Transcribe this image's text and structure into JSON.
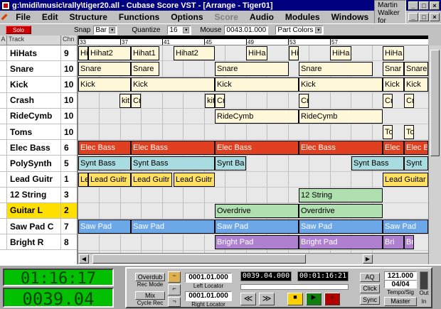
{
  "window": {
    "title": "g:\\midi\\music\\rally\\tiger20.all - Cubase Score VST - [Arrange - Tiger01]"
  },
  "menu": {
    "items": [
      "File",
      "Edit",
      "Structure",
      "Functions",
      "Options",
      "Score",
      "Audio",
      "Modules",
      "Windows"
    ],
    "credit": "Martin Walker for SOS"
  },
  "toolbar": {
    "solo_label": "Solo",
    "snap_label": "Snap",
    "snap_value": "Bar",
    "quantize_label": "Quantize",
    "quantize_value": "16",
    "mouse_label": "Mouse",
    "mouse_value": "0043.01.000",
    "color_value": "Part Colors"
  },
  "tracklist": {
    "header": {
      "a": "A",
      "track": "Track",
      "chn": "Chn"
    },
    "tracks": [
      {
        "name": "HiHats",
        "chn": "9"
      },
      {
        "name": "Snare",
        "chn": "10"
      },
      {
        "name": "Kick",
        "chn": "10"
      },
      {
        "name": "Crash",
        "chn": "10"
      },
      {
        "name": "RideCymb",
        "chn": "10"
      },
      {
        "name": "Toms",
        "chn": "10"
      },
      {
        "name": "Elec Bass",
        "chn": "6"
      },
      {
        "name": "PolySynth",
        "chn": "5"
      },
      {
        "name": "Lead Guitr",
        "chn": "1"
      },
      {
        "name": "12 String",
        "chn": "3"
      },
      {
        "name": "Guitar L",
        "chn": "2"
      },
      {
        "name": "Saw Pad C",
        "chn": "7"
      },
      {
        "name": "Bright R",
        "chn": "8"
      }
    ]
  },
  "ruler": {
    "labels": [
      "33",
      "37",
      "41",
      "45",
      "49",
      "53",
      "57"
    ]
  },
  "parts": [
    {
      "row": 0,
      "color": "#fff8d8",
      "items": [
        [
          "Hi",
          0,
          14
        ],
        [
          "Hihat2",
          14,
          60
        ],
        [
          "Hihat1",
          74,
          40
        ],
        [
          "Hihat2",
          134,
          58
        ],
        [
          "HiHa",
          236,
          30
        ],
        [
          "Hi",
          296,
          14
        ],
        [
          "HiHa",
          354,
          30
        ],
        [
          "HiHa",
          428,
          30
        ]
      ]
    },
    {
      "row": 1,
      "color": "#fff8d8",
      "items": [
        [
          "Snare",
          0,
          74
        ],
        [
          "Snare",
          74,
          40
        ],
        [
          "Snare",
          192,
          104
        ],
        [
          "Snare",
          310,
          104
        ],
        [
          "Snar",
          428,
          30
        ],
        [
          "Snare",
          458,
          34
        ]
      ]
    },
    {
      "row": 2,
      "color": "#fff8d8",
      "items": [
        [
          "Kick",
          0,
          74
        ],
        [
          "Kick",
          74,
          118
        ],
        [
          "Kick",
          192,
          118
        ],
        [
          "Kick",
          310,
          118
        ],
        [
          "Kick",
          428,
          30
        ],
        [
          "Kick",
          458,
          34
        ]
      ]
    },
    {
      "row": 3,
      "color": "#fff8d8",
      "items": [
        [
          "kit",
          58,
          16
        ],
        [
          "Cr",
          74,
          14
        ],
        [
          "kit",
          178,
          14
        ],
        [
          "Cr",
          192,
          14
        ],
        [
          "Cr",
          310,
          14
        ],
        [
          "Cr",
          428,
          14
        ],
        [
          "Cr",
          458,
          14
        ]
      ]
    },
    {
      "row": 4,
      "color": "#fff8d8",
      "items": [
        [
          "RideCymb",
          192,
          118
        ],
        [
          "RideCymb",
          310,
          118
        ]
      ]
    },
    {
      "row": 5,
      "color": "#fff8d8",
      "items": [
        [
          "Toc",
          428,
          14
        ],
        [
          "Toc",
          458,
          14
        ]
      ]
    },
    {
      "row": 6,
      "color": "#e04020",
      "items": [
        [
          "Elec Bass",
          0,
          74
        ],
        [
          "Elec Bass",
          74,
          118
        ],
        [
          "Elec Bass",
          192,
          118
        ],
        [
          "Elec Bass",
          310,
          118
        ],
        [
          "Elec",
          428,
          30
        ],
        [
          "Elec Bass",
          458,
          34
        ]
      ]
    },
    {
      "row": 7,
      "color": "#a8dce0",
      "items": [
        [
          "Synt Bass",
          0,
          74
        ],
        [
          "Synt Bass",
          74,
          118
        ],
        [
          "Synt Ba",
          192,
          44
        ],
        [
          "Synt Bass",
          384,
          74
        ],
        [
          "Synt",
          458,
          34
        ]
      ]
    },
    {
      "row": 8,
      "color": "#ffe060",
      "items": [
        [
          "Le",
          0,
          14
        ],
        [
          "Lead Guitr",
          14,
          60
        ],
        [
          "Lead Guitr",
          74,
          58
        ],
        [
          "Lead Guitr",
          134,
          58
        ],
        [
          "Lead Guitar",
          428,
          64
        ]
      ]
    },
    {
      "row": 9,
      "color": "#b0e0b0",
      "items": [
        [
          "12 String",
          310,
          118
        ]
      ]
    },
    {
      "row": 10,
      "color": "#b0e0b0",
      "items": [
        [
          "Overdrive",
          192,
          118
        ],
        [
          "Overdrive",
          310,
          118
        ]
      ]
    },
    {
      "row": 11,
      "color": "#6ca8e8",
      "items": [
        [
          "Saw Pad",
          0,
          74
        ],
        [
          "Saw Pad",
          74,
          118
        ],
        [
          "Saw Pad",
          192,
          118
        ],
        [
          "Saw Pad",
          310,
          118
        ],
        [
          "Saw Pad",
          428,
          64
        ]
      ]
    },
    {
      "row": 12,
      "color": "#b080d0",
      "items": [
        [
          "Bright Pad",
          192,
          118
        ],
        [
          "Bright Pad",
          310,
          118
        ],
        [
          "Bri",
          428,
          30
        ],
        [
          "Br",
          458,
          14
        ]
      ]
    }
  ],
  "transport": {
    "time": "01:16:17",
    "position": "0039.04",
    "overdub": "Overdub",
    "rec_mode": "Rec Mode",
    "mix": "Mix",
    "cycle_rec": "Cycle Rec",
    "left_locator": "0001.01.000",
    "left_locator_label": "Left Locator",
    "right_locator": "0001.01.000",
    "right_locator_label": "Right Locator",
    "song_position": "0039.04.000",
    "song_time": "00:01:16:21",
    "aq": "AQ",
    "click": "Click",
    "sync": "Sync",
    "tempo": "121.000",
    "signature": "04/04",
    "tempo_label": "Tempo/Sig",
    "master": "Master",
    "out": "Out",
    "in": "In"
  }
}
